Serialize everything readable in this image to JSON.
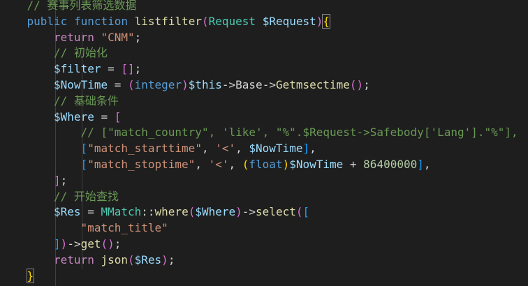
{
  "code_lines": [
    {
      "indent": 4,
      "tokens": [
        {
          "t": "// 赛事列表筛选数据",
          "c": "c-comment"
        }
      ]
    },
    {
      "indent": 4,
      "tokens": [
        {
          "t": "public function ",
          "c": "c-kw"
        },
        {
          "t": "listfilter",
          "c": "c-fn"
        },
        {
          "t": "(",
          "c": "c-brk2"
        },
        {
          "t": "Request",
          "c": "c-type"
        },
        {
          "t": " ",
          "c": "c-punc"
        },
        {
          "t": "$Request",
          "c": "c-var"
        },
        {
          "t": ")",
          "c": "c-brk2"
        },
        {
          "t": "{",
          "c": "c-brk1",
          "match": true
        }
      ]
    },
    {
      "indent": 8,
      "tokens": [
        {
          "t": "return ",
          "c": "c-ctrl"
        },
        {
          "t": "\"CNM\"",
          "c": "c-str"
        },
        {
          "t": ";",
          "c": "c-punc"
        }
      ]
    },
    {
      "indent": 8,
      "tokens": [
        {
          "t": "// 初始化",
          "c": "c-comment"
        }
      ]
    },
    {
      "indent": 8,
      "tokens": [
        {
          "t": "$filter",
          "c": "c-var"
        },
        {
          "t": " = ",
          "c": "c-punc"
        },
        {
          "t": "[]",
          "c": "c-brk2"
        },
        {
          "t": ";",
          "c": "c-punc"
        }
      ]
    },
    {
      "indent": 8,
      "tokens": [
        {
          "t": "$NowTime",
          "c": "c-var"
        },
        {
          "t": " = ",
          "c": "c-punc"
        },
        {
          "t": "(",
          "c": "c-brk2"
        },
        {
          "t": "integer",
          "c": "c-kw"
        },
        {
          "t": ")",
          "c": "c-brk2"
        },
        {
          "t": "$this",
          "c": "c-var"
        },
        {
          "t": "->",
          "c": "c-punc"
        },
        {
          "t": "Base",
          "c": "c-punc"
        },
        {
          "t": "->",
          "c": "c-punc"
        },
        {
          "t": "Getmsectime",
          "c": "c-fn"
        },
        {
          "t": "()",
          "c": "c-brk2"
        },
        {
          "t": ";",
          "c": "c-punc"
        }
      ]
    },
    {
      "indent": 8,
      "tokens": [
        {
          "t": "// 基础条件",
          "c": "c-comment"
        }
      ]
    },
    {
      "indent": 8,
      "tokens": [
        {
          "t": "$Where",
          "c": "c-var"
        },
        {
          "t": " = ",
          "c": "c-punc"
        },
        {
          "t": "[",
          "c": "c-brk2"
        }
      ]
    },
    {
      "indent": 12,
      "tokens": [
        {
          "t": "// [\"match_country\", 'like', \"%\".$Request->Safebody['Lang'].\"%\"],",
          "c": "c-comment"
        }
      ]
    },
    {
      "indent": 12,
      "tokens": [
        {
          "t": "[",
          "c": "c-brk3"
        },
        {
          "t": "\"match_starttime\"",
          "c": "c-str"
        },
        {
          "t": ", ",
          "c": "c-punc"
        },
        {
          "t": "'<'",
          "c": "c-str"
        },
        {
          "t": ", ",
          "c": "c-punc"
        },
        {
          "t": "$NowTime",
          "c": "c-var"
        },
        {
          "t": "]",
          "c": "c-brk3"
        },
        {
          "t": ",",
          "c": "c-punc"
        }
      ]
    },
    {
      "indent": 12,
      "tokens": [
        {
          "t": "[",
          "c": "c-brk3"
        },
        {
          "t": "\"match_stoptime\"",
          "c": "c-str"
        },
        {
          "t": ", ",
          "c": "c-punc"
        },
        {
          "t": "'<'",
          "c": "c-str"
        },
        {
          "t": ", ",
          "c": "c-punc"
        },
        {
          "t": "(",
          "c": "c-brk1"
        },
        {
          "t": "float",
          "c": "c-kw"
        },
        {
          "t": ")",
          "c": "c-brk1"
        },
        {
          "t": "$NowTime",
          "c": "c-var"
        },
        {
          "t": " + ",
          "c": "c-punc"
        },
        {
          "t": "86400000",
          "c": "c-num"
        },
        {
          "t": "]",
          "c": "c-brk3"
        },
        {
          "t": ",",
          "c": "c-punc"
        }
      ]
    },
    {
      "indent": 8,
      "tokens": [
        {
          "t": "]",
          "c": "c-brk2"
        },
        {
          "t": ";",
          "c": "c-punc"
        }
      ]
    },
    {
      "indent": 8,
      "tokens": [
        {
          "t": "// 开始查找",
          "c": "c-comment"
        }
      ]
    },
    {
      "indent": 8,
      "tokens": [
        {
          "t": "$Res",
          "c": "c-var"
        },
        {
          "t": " = ",
          "c": "c-punc"
        },
        {
          "t": "MMatch",
          "c": "c-type"
        },
        {
          "t": "::",
          "c": "c-punc"
        },
        {
          "t": "where",
          "c": "c-fn"
        },
        {
          "t": "(",
          "c": "c-brk2"
        },
        {
          "t": "$Where",
          "c": "c-var"
        },
        {
          "t": ")",
          "c": "c-brk2"
        },
        {
          "t": "->",
          "c": "c-punc"
        },
        {
          "t": "select",
          "c": "c-fn"
        },
        {
          "t": "(",
          "c": "c-brk2"
        },
        {
          "t": "[",
          "c": "c-brk3"
        }
      ]
    },
    {
      "indent": 12,
      "tokens": [
        {
          "t": "\"match_title\"",
          "c": "c-str"
        }
      ]
    },
    {
      "indent": 8,
      "tokens": [
        {
          "t": "]",
          "c": "c-brk3"
        },
        {
          "t": ")",
          "c": "c-brk2"
        },
        {
          "t": "->",
          "c": "c-punc"
        },
        {
          "t": "get",
          "c": "c-fn"
        },
        {
          "t": "()",
          "c": "c-brk2"
        },
        {
          "t": ";",
          "c": "c-punc"
        }
      ]
    },
    {
      "indent": 8,
      "tokens": [
        {
          "t": "return ",
          "c": "c-ctrl"
        },
        {
          "t": "json",
          "c": "c-fn"
        },
        {
          "t": "(",
          "c": "c-brk2"
        },
        {
          "t": "$Res",
          "c": "c-var"
        },
        {
          "t": ")",
          "c": "c-brk2"
        },
        {
          "t": ";",
          "c": "c-punc"
        }
      ]
    },
    {
      "indent": 4,
      "tokens": [
        {
          "t": "}",
          "c": "c-brk1",
          "match": true
        }
      ]
    }
  ],
  "colors": {
    "background": "#1e1e1e",
    "comment": "#6a9955",
    "keyword": "#569cd6",
    "control": "#c586c0",
    "function": "#dcdcaa",
    "string": "#ce9178",
    "variable": "#9cdcfe",
    "type": "#4ec9b0",
    "number": "#b5cea8",
    "bracket_gold": "#ffd700",
    "bracket_orchid": "#da70d6",
    "bracket_blue": "#179fff"
  }
}
